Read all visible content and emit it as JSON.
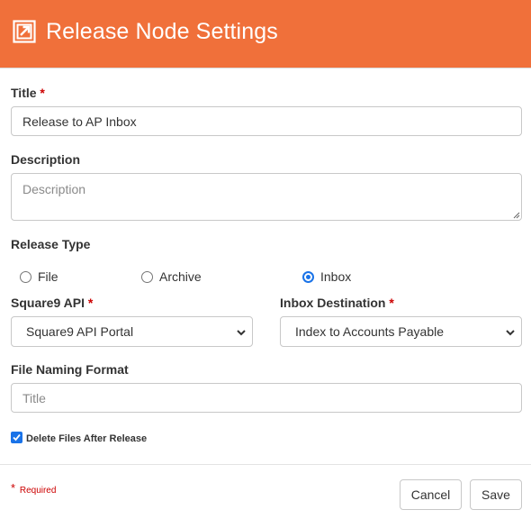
{
  "header": {
    "title": "Release Node Settings",
    "icon": "release-arrow-icon",
    "background_color": "#f0703a"
  },
  "form": {
    "title": {
      "label": "Title",
      "required_mark": "*",
      "value": "Release to AP Inbox"
    },
    "description": {
      "label": "Description",
      "placeholder": "Description",
      "value": ""
    },
    "release_type": {
      "label": "Release Type",
      "options": [
        {
          "label": "File",
          "checked": false
        },
        {
          "label": "Archive",
          "checked": false
        },
        {
          "label": "Inbox",
          "checked": true
        }
      ]
    },
    "square9_api": {
      "label": "Square9 API",
      "required_mark": "*",
      "selected": "Square9 API Portal"
    },
    "inbox_destination": {
      "label": "Inbox Destination",
      "required_mark": "*",
      "selected": "Index to Accounts Payable"
    },
    "file_naming_format": {
      "label": "File Naming Format",
      "placeholder": "Title",
      "value": ""
    },
    "delete_files": {
      "label": "Delete Files After Release",
      "checked": true
    }
  },
  "footer": {
    "required_star": "*",
    "required_text": "Required",
    "cancel_label": "Cancel",
    "save_label": "Save"
  },
  "colors": {
    "accent": "#f0703a",
    "required": "#cc0000",
    "checked": "#1a73e8"
  }
}
